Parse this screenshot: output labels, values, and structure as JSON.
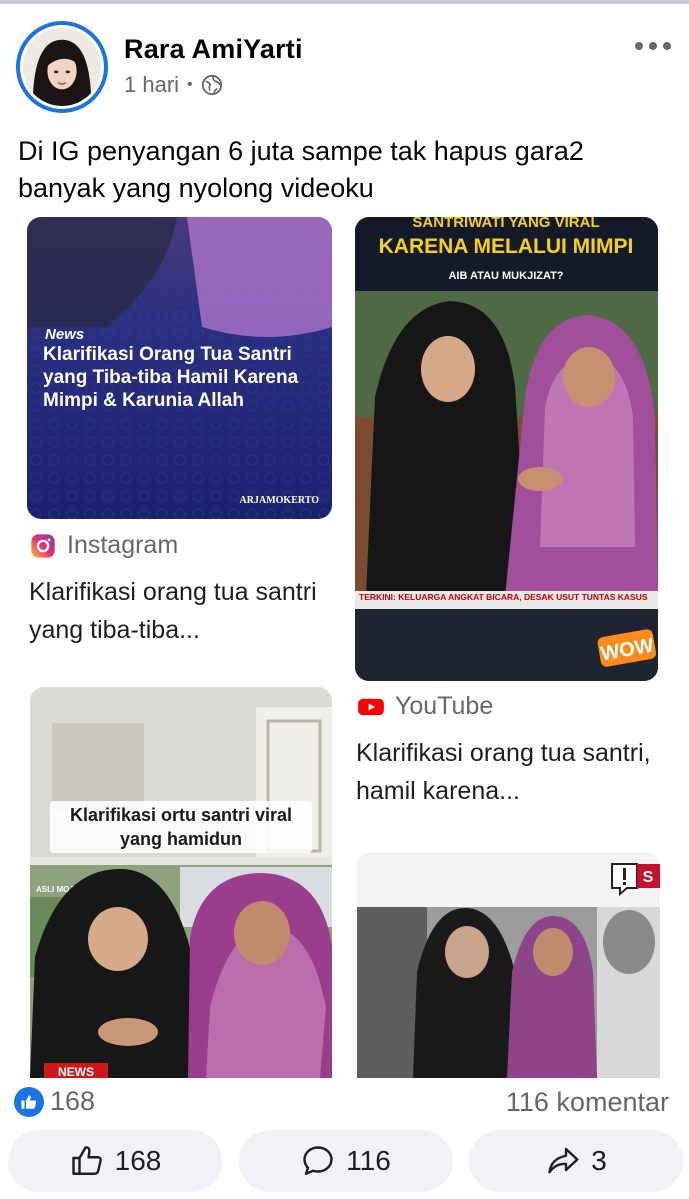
{
  "post": {
    "author": "Rara AmiYarti",
    "time": "1 hari",
    "time_separator": "•",
    "privacy_icon": "globe-icon",
    "text": "Di IG penyangan 6 juta sampe tak hapus gara2 banyak yang nyolong videoku"
  },
  "cards": [
    {
      "image": {
        "tag": "News",
        "headline": "Klarifikasi Orang Tua Santri yang Tiba-tiba Hamil Karena Mimpi & Karunia Allah",
        "watermark": "ARJAMOKERTO"
      },
      "source": "Instagram",
      "source_icon": "instagram-icon",
      "title": "Klarifikasi orang tua santri yang tiba-tiba..."
    },
    {
      "image": {
        "banner_top": "SANTRIWATI YANG VIRAL",
        "banner": "KARENA MELALUI MIMPI",
        "sub_banner": "AIB ATAU MUKJIZAT?",
        "ticker": "TERKINI: KELUARGA ANGKAT BICARA, DESAK USUT TUNTAS KASUS",
        "badge": "WOW"
      },
      "source": "YouTube",
      "source_icon": "youtube-icon",
      "title": "Klarifikasi orang tua santri, hamil karena..."
    },
    {
      "image": {
        "caption": "Klarifikasi ortu santri viral yang hamidun",
        "tag": "NEWS",
        "corner": "ASLI MOJOKERTO"
      }
    },
    {
      "image": {
        "badge": "S"
      }
    }
  ],
  "reactions": {
    "count": "168",
    "comments": "116 komentar"
  },
  "actions": {
    "like": "168",
    "comment": "116",
    "share": "3"
  },
  "colors": {
    "accent": "#1b74e4",
    "youtube": "#ff0000",
    "news_bg": "#1e2a78",
    "banner_yellow": "#f5d312"
  }
}
